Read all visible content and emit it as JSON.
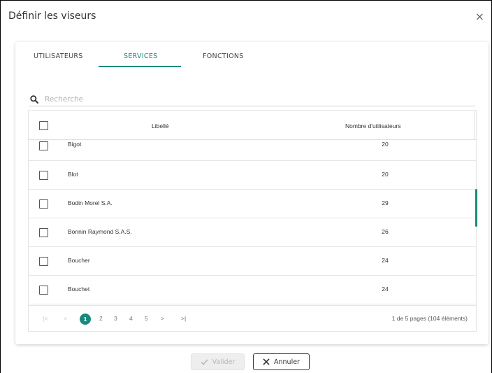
{
  "dialog": {
    "title": "Définir les viseurs",
    "close_label": "×"
  },
  "tabs": [
    {
      "label": "UTILISATEURS",
      "active": false
    },
    {
      "label": "SERVICES",
      "active": true
    },
    {
      "label": "FONCTIONS",
      "active": false
    }
  ],
  "search": {
    "placeholder": "Recherche",
    "value": ""
  },
  "grid": {
    "columns": {
      "label": "Libellé",
      "count": "Nombre d'utilisateurs"
    },
    "rows": [
      {
        "label": "Bigot",
        "count": "20"
      },
      {
        "label": "Blot",
        "count": "20"
      },
      {
        "label": "Bodin Morel S.A.",
        "count": "29"
      },
      {
        "label": "Bonnin Raymond S.A.S.",
        "count": "26"
      },
      {
        "label": "Boucher",
        "count": "24"
      },
      {
        "label": "Bouchet",
        "count": "24"
      }
    ]
  },
  "pager": {
    "first": "|<",
    "prev": "<",
    "pages": [
      "1",
      "2",
      "3",
      "4",
      "5"
    ],
    "current_page": "1",
    "next": ">",
    "last": ">|",
    "info": "1 de 5 pages (104 éléments)"
  },
  "buttons": {
    "validate": "Valider",
    "cancel": "Annuler"
  },
  "colors": {
    "accent": "#178a7e"
  },
  "icons": {
    "search": "search-icon",
    "close": "close-icon",
    "check": "check-icon",
    "cancel": "x-icon"
  }
}
